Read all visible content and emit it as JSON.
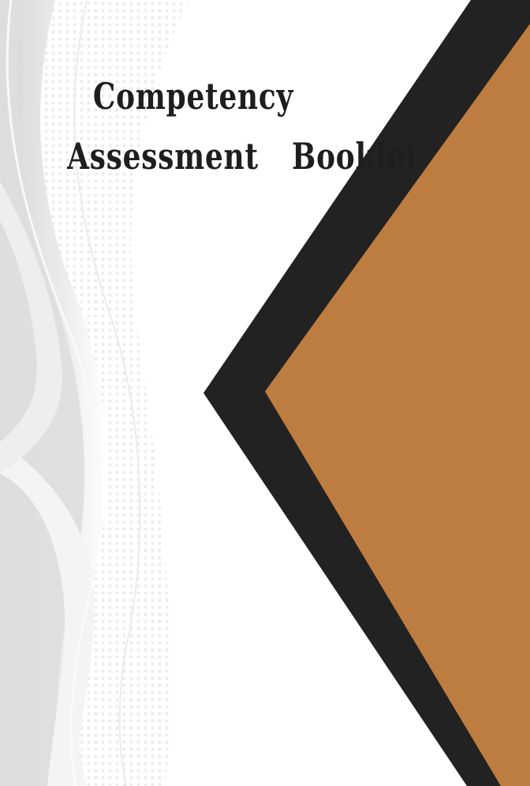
{
  "cover": {
    "title_line_1": "Competency",
    "title_line_2": "Assessment  Booklet",
    "colors": {
      "background": "#ffffff",
      "title_text": "#1e1e1e",
      "chevron_border": "#222222",
      "chevron_fill": "#be7d40",
      "wave_light": "#e9e9e9",
      "wave_mid": "#d8d8d8"
    }
  }
}
